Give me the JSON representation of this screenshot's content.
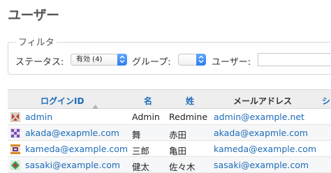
{
  "page": {
    "title": "ユーザー"
  },
  "filter": {
    "legend": "フィルタ",
    "status_label": "ステータス:",
    "status_selected": "有効 (4)",
    "group_label": "グループ:",
    "group_selected": "",
    "user_label": "ユーザー:",
    "user_value": ""
  },
  "table": {
    "headers": {
      "login": "ログインID",
      "first_name": "名",
      "last_name": "姓",
      "email": "メールアドレス",
      "extra": "シ"
    },
    "sort_indicator": "ascending",
    "rows": [
      {
        "login": "admin",
        "first_name": "Admin",
        "last_name": "Redmine",
        "email": "admin@example.net",
        "avatar_color": "#c03a3a"
      },
      {
        "login": "akada@exapmle.com",
        "first_name": "舞",
        "last_name": "赤田",
        "email": "akada@exapmle.com",
        "avatar_color": "#7a4ab0"
      },
      {
        "login": "kameda@example.com",
        "first_name": "三郎",
        "last_name": "亀田",
        "email": "kameda@example.com",
        "avatar_color": "#d88a2a"
      },
      {
        "login": "sasaki@example.com",
        "first_name": "健太",
        "last_name": "佐々木",
        "email": "sasaki@example.com",
        "avatar_color": "#3a9a5a"
      }
    ]
  },
  "colors": {
    "link": "#1d6bb8",
    "select_arrow": "#2f7cf0",
    "header_bg": "#eeeeee"
  }
}
